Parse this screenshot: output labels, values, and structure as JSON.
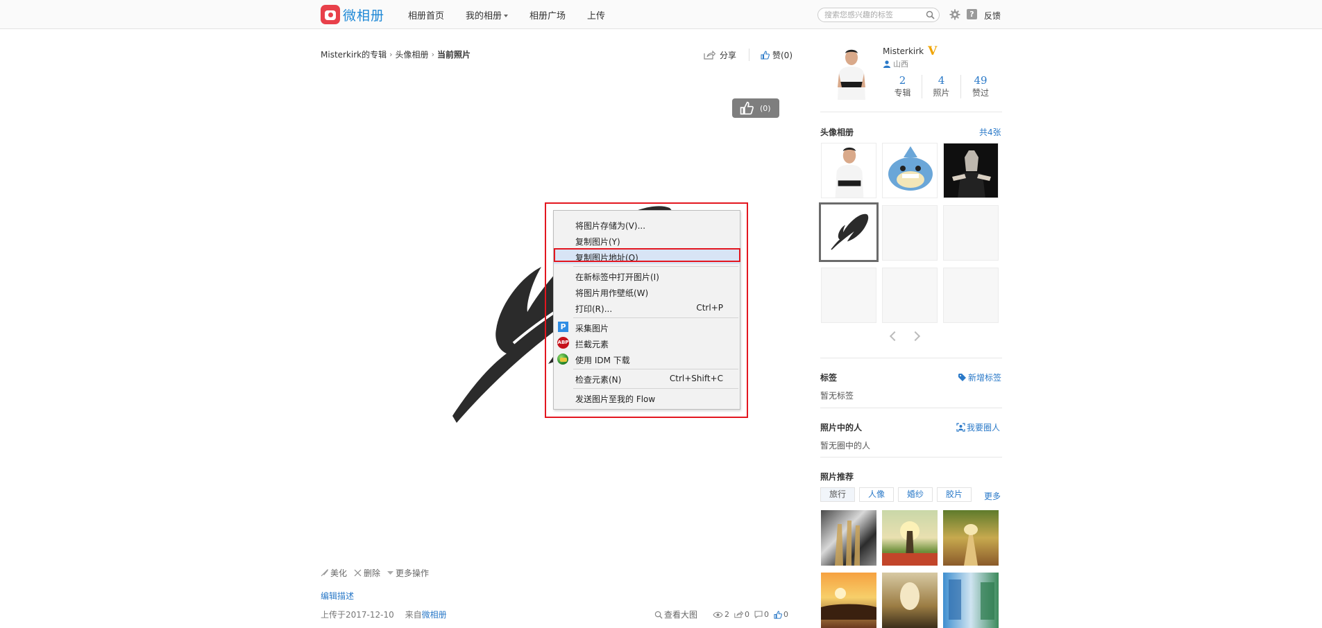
{
  "header": {
    "logo_text": "微相册",
    "nav": [
      {
        "label": "相册首页"
      },
      {
        "label": "我的相册"
      },
      {
        "label": "相册广场"
      },
      {
        "label": "上传"
      }
    ],
    "search_placeholder": "搜索您感兴趣的标签",
    "feedback_label": "反馈"
  },
  "breadcrumb": {
    "items": [
      "Misterkirk的专辑",
      "头像相册",
      "当前照片"
    ]
  },
  "actions": {
    "share_label": "分享",
    "like_label": "赞(0)",
    "float_like_count": "(0)"
  },
  "context_menu": {
    "items": [
      {
        "label": "将图片存储为(V)..."
      },
      {
        "label": "复制图片(Y)"
      },
      {
        "label": "复制图片地址(O)"
      },
      {
        "label": "在新标签中打开图片(I)"
      },
      {
        "label": "将图片用作壁纸(W)"
      },
      {
        "label": "打印(R)...",
        "shortcut": "Ctrl+P"
      },
      {
        "label": "采集图片"
      },
      {
        "label": "拦截元素"
      },
      {
        "label": "使用 IDM 下载"
      },
      {
        "label": "检查元素(N)",
        "shortcut": "Ctrl+Shift+C"
      },
      {
        "label": "发送图片至我的 Flow"
      }
    ],
    "highlighted_index": 2,
    "icons": {
      "p_label": "P",
      "abp_label": "ABP"
    }
  },
  "photo_tools": {
    "beautify": "美化",
    "delete": "删除",
    "more": "更多操作",
    "edit_desc": "编辑描述",
    "uploaded": "上传于2017-12-10",
    "from_prefix": "来自",
    "from_source": "微相册",
    "view_large": "查看大图",
    "views": "2",
    "shares": "0",
    "comments": "0",
    "likes": "0"
  },
  "profile": {
    "name": "Misterkirk",
    "badge": "V",
    "location": "山西",
    "stats": [
      {
        "value": "2",
        "label": "专辑"
      },
      {
        "value": "4",
        "label": "照片"
      },
      {
        "value": "49",
        "label": "赞过"
      }
    ]
  },
  "album": {
    "title": "头像相册",
    "count_link": "共4张"
  },
  "tags": {
    "title": "标签",
    "add_link": "新增标签",
    "empty": "暂无标签"
  },
  "people": {
    "title": "照片中的人",
    "circle_link": "我要圈人",
    "empty": "暂无圈中的人"
  },
  "recommend": {
    "title": "照片推荐",
    "tabs": [
      "旅行",
      "人像",
      "婚纱",
      "胶片"
    ],
    "more": "更多"
  },
  "colors": {
    "accent": "#2a79c8",
    "highlight_red": "#e3161f",
    "brand_red": "#e8404a"
  }
}
